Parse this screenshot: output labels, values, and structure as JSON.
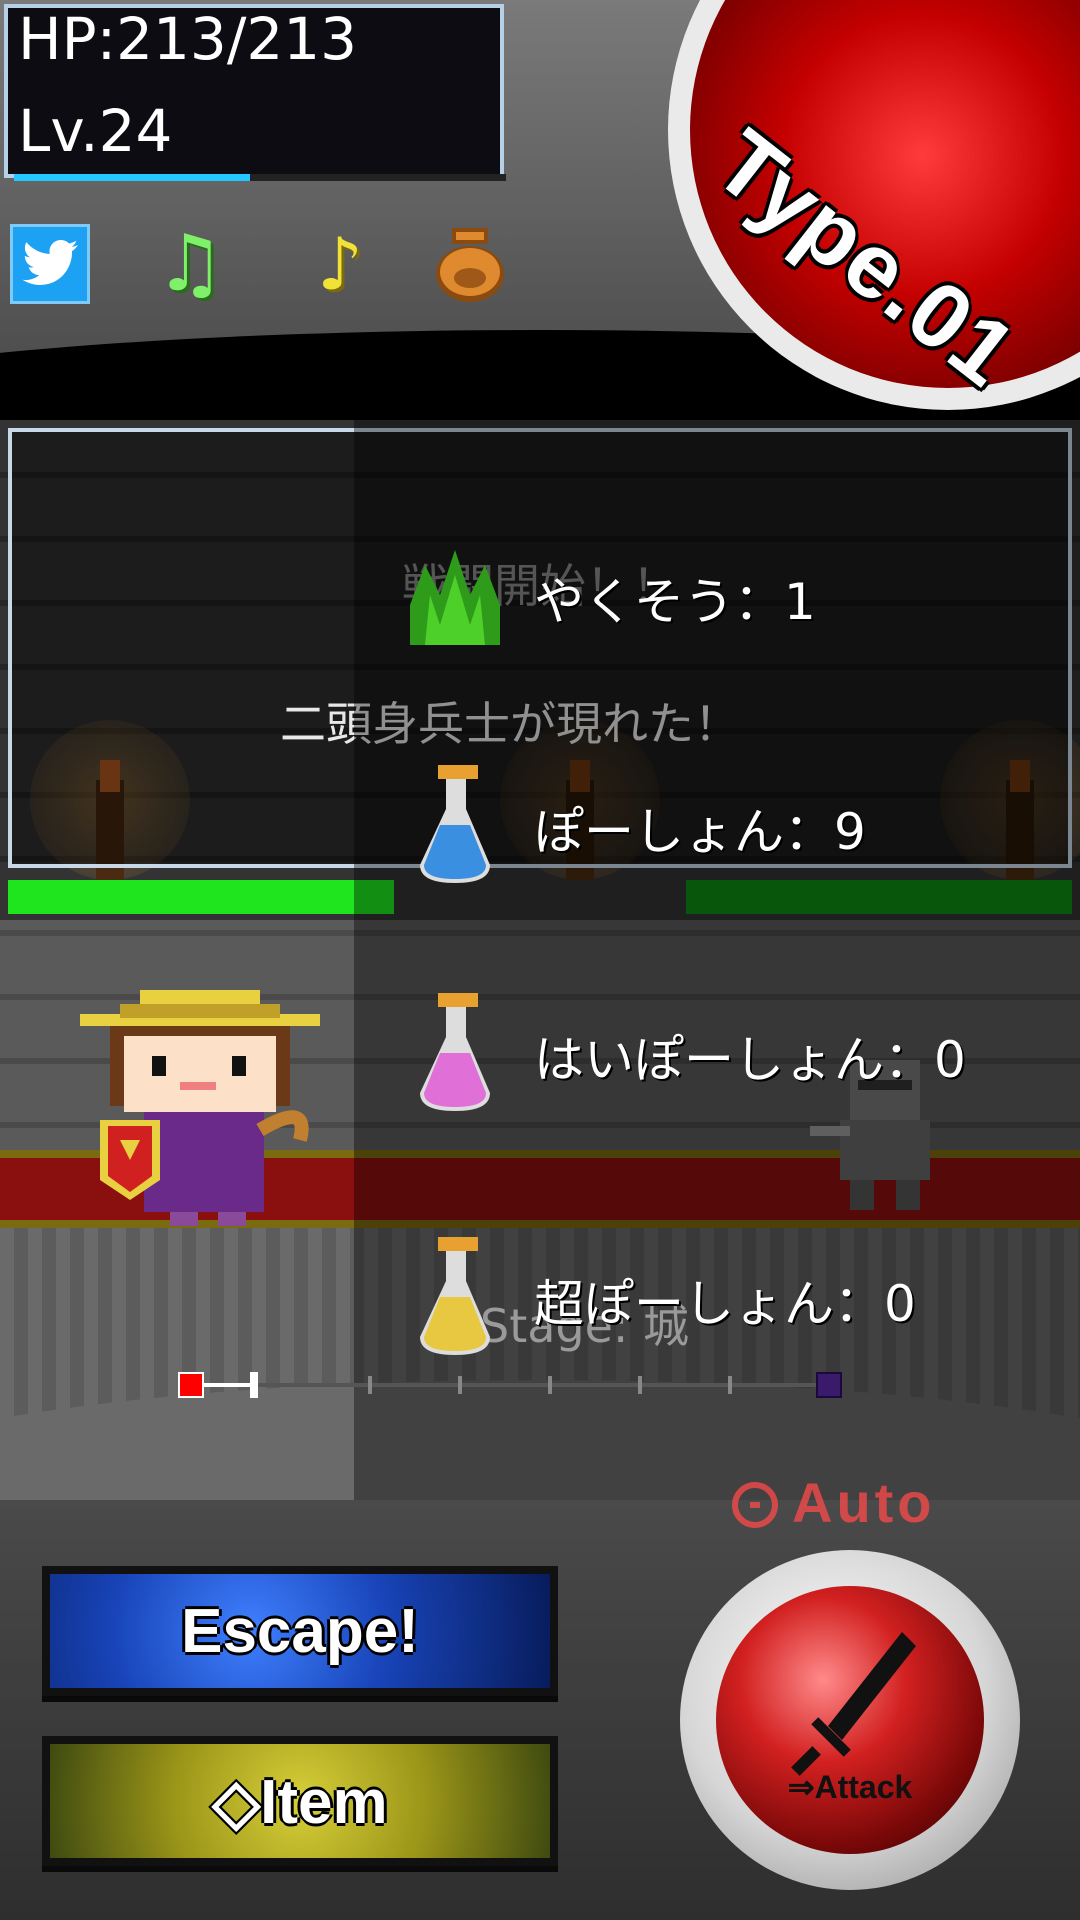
{
  "player": {
    "hp_text": "HP:213/213",
    "level_text": "Lv.24",
    "xp_fraction": 0.48
  },
  "toolbar": {
    "icons": [
      "twitter-icon",
      "music-icon",
      "sound-icon",
      "bag-icon"
    ]
  },
  "mode": {
    "type_label": "Type.01"
  },
  "battle": {
    "message_1": "戦闘開始！！",
    "message_2": "二頭身兵士が現れた！",
    "player_hp_fraction": 1.0,
    "enemy_hp_fraction": 1.0,
    "stage_text": "Stage: 城",
    "stage_progress_fraction": 0.1
  },
  "items": [
    {
      "label": "やくそう：1",
      "icon": "herb-icon",
      "color": "#2e9b1a"
    },
    {
      "label": "ぽーしょん：9",
      "icon": "blue-potion-icon",
      "color": "#3a8fe0"
    },
    {
      "label": "はいぽーしょん：0",
      "icon": "pink-potion-icon",
      "color": "#e070d8"
    },
    {
      "label": "超ぽーしょん：0",
      "icon": "yellow-potion-icon",
      "color": "#e8c840"
    }
  ],
  "controls": {
    "auto_label": "Auto",
    "escape_label": "Escape!",
    "item_label": "◇Item",
    "attack_label": "⇒Attack"
  },
  "colors": {
    "player_hp": "#1ee51e",
    "enemy_hp": "#0d8a14",
    "xp": "#22c8ff",
    "auto": "#ff4a4a"
  }
}
